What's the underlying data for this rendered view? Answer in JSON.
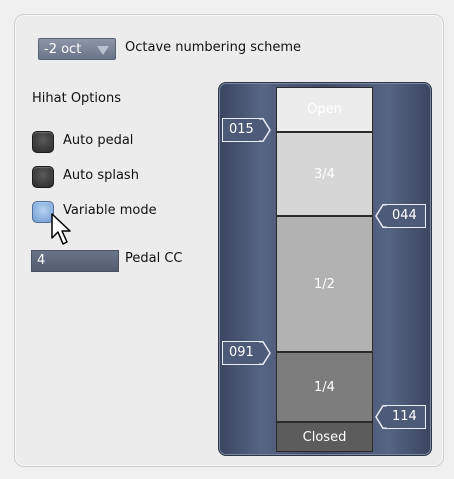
{
  "octave": {
    "value": "-2 oct",
    "label": "Octave numbering scheme"
  },
  "hihat": {
    "heading": "Hihat Options",
    "options": [
      {
        "label": "Auto pedal",
        "checked": false
      },
      {
        "label": "Auto splash",
        "checked": false
      },
      {
        "label": "Variable mode",
        "checked": true
      }
    ],
    "pedal_cc": {
      "value": "4",
      "label": "Pedal CC"
    }
  },
  "zones": [
    {
      "label": "Open",
      "color": "#ececec"
    },
    {
      "label": "3/4",
      "color": "#d6d6d6"
    },
    {
      "label": "1/2",
      "color": "#b2b2b2"
    },
    {
      "label": "1/4",
      "color": "#7d7d7d"
    },
    {
      "label": "Closed",
      "color": "#5c5c5c"
    }
  ],
  "thresholds": {
    "left": [
      "015",
      "091"
    ],
    "right": [
      "044",
      "114"
    ]
  },
  "colors": {
    "accent": "#6f9bd0",
    "rail": "#4d5b78"
  }
}
